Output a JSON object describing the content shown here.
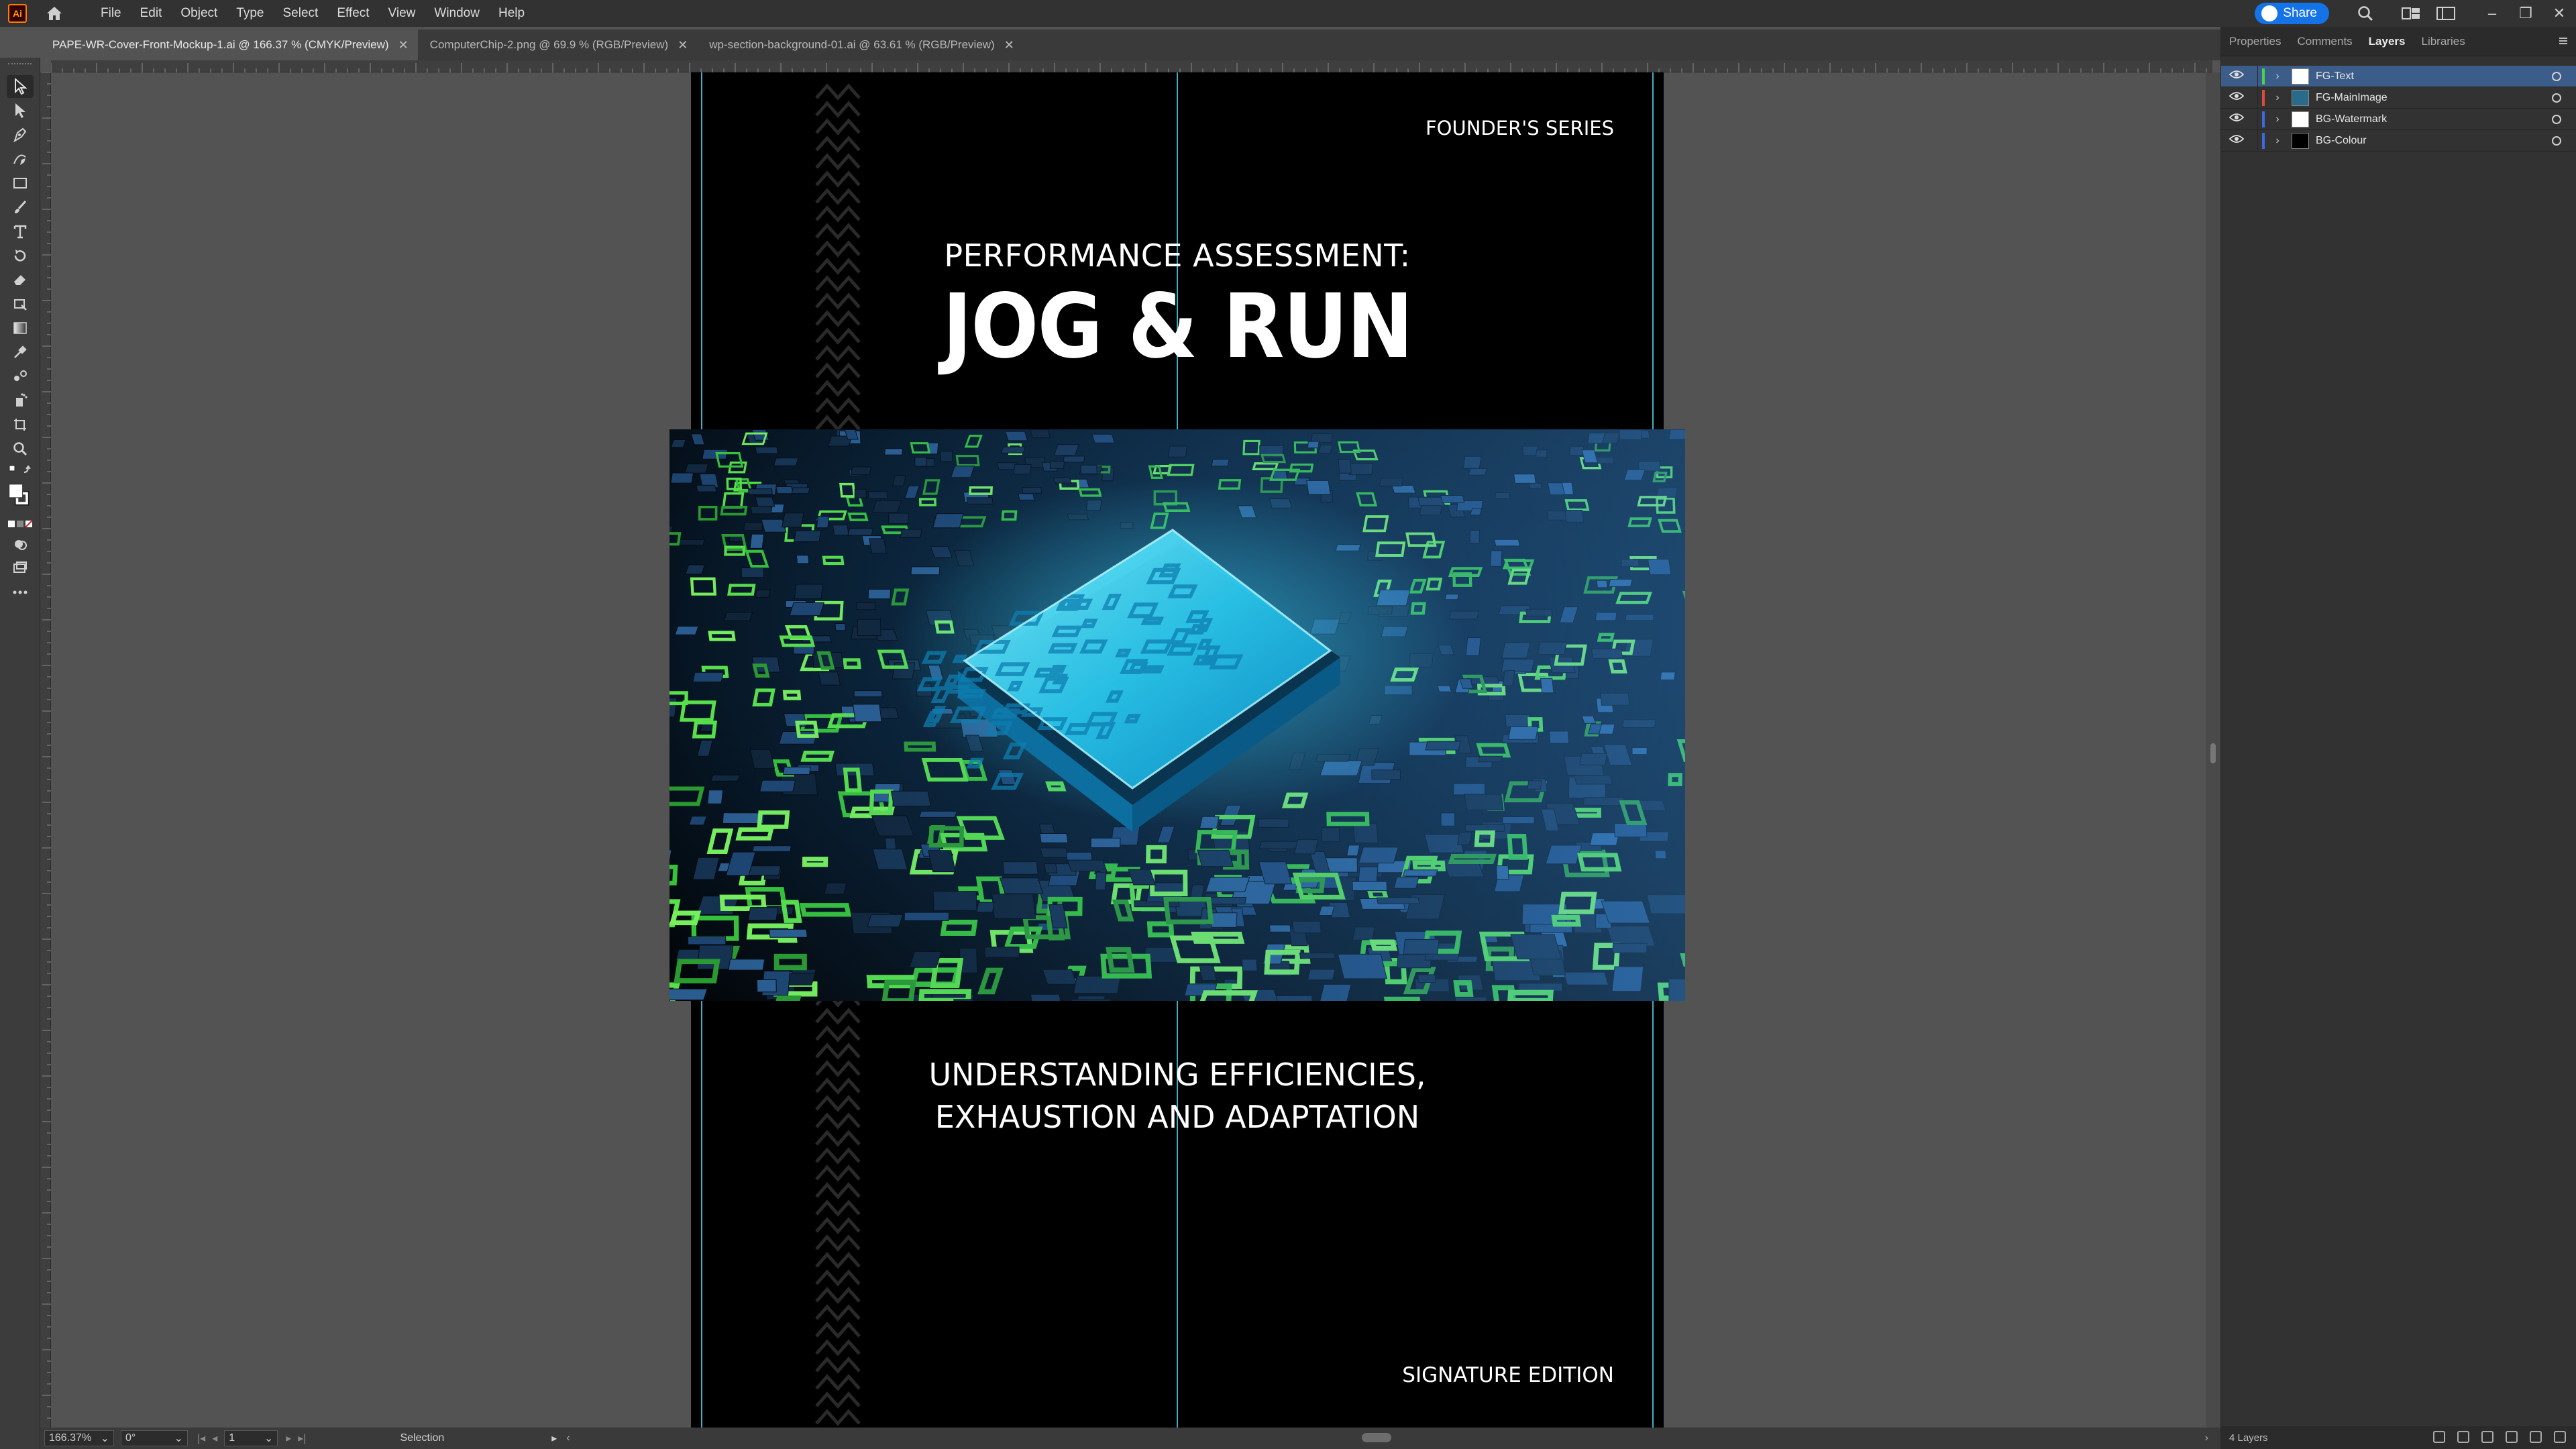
{
  "app": {
    "logo_text": "Ai"
  },
  "menu": [
    "File",
    "Edit",
    "Object",
    "Type",
    "Select",
    "Effect",
    "View",
    "Window",
    "Help"
  ],
  "share_label": "Share",
  "tabs": [
    {
      "label": "PAPE-WR-Cover-Front-Mockup-1.ai @ 166.37 % (CMYK/Preview)",
      "active": true
    },
    {
      "label": "ComputerChip-2.png @ 69.9 % (RGB/Preview)",
      "active": false
    },
    {
      "label": "wp-section-background-01.ai @ 63.61 % (RGB/Preview)",
      "active": false
    }
  ],
  "tab_close_glyph": "✕",
  "cover": {
    "series": "FOUNDER'S SERIES",
    "title_small": "PERFORMANCE ASSESSMENT:",
    "title_large": "JOG & RUN",
    "subtitle_line1": "UNDERSTANDING EFFICIENCIES,",
    "subtitle_line2": "EXHAUSTION AND ADAPTATION",
    "edition": "SIGNATURE EDITION"
  },
  "status": {
    "zoom": "166.37%",
    "rotation": "0°",
    "artboard": "1",
    "tool": "Selection"
  },
  "panel": {
    "tabs": [
      "Properties",
      "Comments",
      "Layers",
      "Libraries"
    ],
    "active_tab": "Layers",
    "layers": [
      {
        "name": "FG-Text",
        "color": "#4fcf4f",
        "selected": true,
        "thumb": "#ffffff"
      },
      {
        "name": "FG-MainImage",
        "color": "#e04a3a",
        "selected": false,
        "thumb": "#2a6a8a"
      },
      {
        "name": "BG-Watermark",
        "color": "#3a6ae0",
        "selected": false,
        "thumb": "#ffffff"
      },
      {
        "name": "BG-Colour",
        "color": "#3a6ae0",
        "selected": false,
        "thumb": "#000000"
      }
    ],
    "footer_count": "4 Layers"
  },
  "colors": {
    "accent": "#1473e6",
    "guide": "#3fb0c8"
  }
}
